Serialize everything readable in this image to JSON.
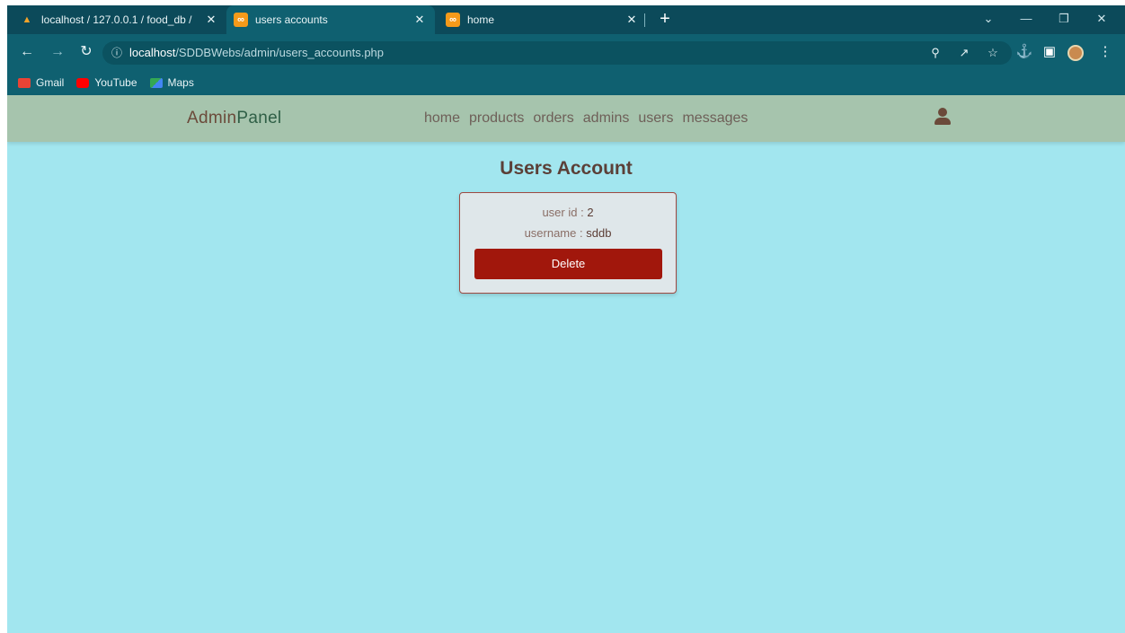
{
  "browser": {
    "tabs": [
      {
        "title": "localhost / 127.0.0.1 / food_db / ",
        "favicon": "phpmyadmin-icon"
      },
      {
        "title": "users accounts",
        "favicon": "xampp-icon",
        "active": true
      },
      {
        "title": "home",
        "favicon": "xampp-icon"
      }
    ],
    "new_tab_label": "+",
    "url_host": "localhost",
    "url_path": "/SDDBWebs/admin/users_accounts.php",
    "bookmarks": [
      "Gmail",
      "YouTube",
      "Maps"
    ]
  },
  "header": {
    "logo_part1": "Admin",
    "logo_part2": "Panel",
    "nav": [
      "home",
      "products",
      "orders",
      "admins",
      "users",
      "messages"
    ]
  },
  "main": {
    "title": "Users Account",
    "user": {
      "id_label": "user id :",
      "id_value": "2",
      "username_label": "username :",
      "username_value": "sddb",
      "delete_label": "Delete"
    }
  },
  "colors": {
    "page_bg": "#a2e6ef",
    "header_bg": "#a6c4ad",
    "delete_button": "#a1170c",
    "browser_chrome": "#0f6070"
  }
}
